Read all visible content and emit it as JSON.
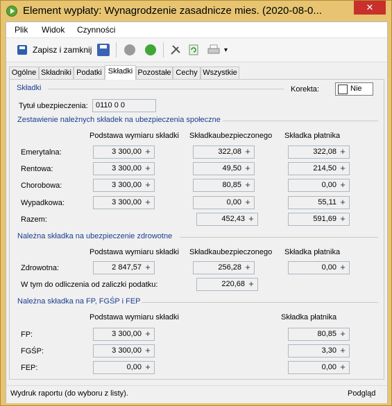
{
  "window": {
    "title": "Element wypłaty: Wynagrodzenie zasadnicze mies. (2020-08-0...",
    "close_label": "✕"
  },
  "menu": [
    "Plik",
    "Widok",
    "Czynności"
  ],
  "toolbar": {
    "save_close_label": "Zapisz i zamknij",
    "dropdown_label": "▾"
  },
  "tabs": [
    "Ogólne",
    "Składniki",
    "Podatki",
    "Składki",
    "Pozostałe",
    "Cechy",
    "Wszystkie"
  ],
  "active_tab": "Składki",
  "skladki": {
    "header": "Składki",
    "korekta_label": "Korekta:",
    "korekta_value": "Nie",
    "tytul_label": "Tytuł ubezpieczenia:",
    "tytul_value": "0110 0 0"
  },
  "spoleczne": {
    "header": "Zestawienie należnych składek na ubezpieczenia społeczne",
    "col_podstawa": "Podstawa wymiaru składki",
    "col_ubezp": "Składkaubezpieczonego",
    "col_platnika": "Składka płatnika",
    "rows": [
      {
        "label": "Emerytalna:",
        "podstawa": "3 300,00",
        "ubezp": "322,08",
        "platnika": "322,08"
      },
      {
        "label": "Rentowa:",
        "podstawa": "3 300,00",
        "ubezp": "49,50",
        "platnika": "214,50"
      },
      {
        "label": "Chorobowa:",
        "podstawa": "3 300,00",
        "ubezp": "80,85",
        "platnika": "0,00"
      },
      {
        "label": "Wypadkowa:",
        "podstawa": "3 300,00",
        "ubezp": "0,00",
        "platnika": "55,11"
      }
    ],
    "razem_label": "Razem:",
    "razem_ubezp": "452,43",
    "razem_platnika": "591,69"
  },
  "zdrowotne": {
    "header": "Należna składka na ubezpieczenie zdrowotne",
    "col_podstawa": "Podstawa wymiaru składki",
    "col_ubezp": "Składkaubezpieczonego",
    "col_platnika": "Składka płatnika",
    "label": "Zdrowotna:",
    "podstawa": "2 847,57",
    "ubezp": "256,28",
    "platnika": "0,00",
    "odlicz_label": "W tym do odliczenia od zaliczki podatku:",
    "odlicz_value": "220,68"
  },
  "fp": {
    "header": "Należna składka na FP, FGŚP i FEP",
    "col_podstawa": "Podstawa wymiaru składki",
    "col_platnika": "Składka płatnika",
    "rows": [
      {
        "label": "FP:",
        "podstawa": "3 300,00",
        "platnika": "80,85"
      },
      {
        "label": "FGŚP:",
        "podstawa": "3 300,00",
        "platnika": "3,30"
      },
      {
        "label": "FEP:",
        "podstawa": "0,00",
        "platnika": "0,00"
      }
    ]
  },
  "status": {
    "left": "Wydruk raportu (do wyboru z listy).",
    "right": "Podgląd"
  },
  "plus": "+"
}
